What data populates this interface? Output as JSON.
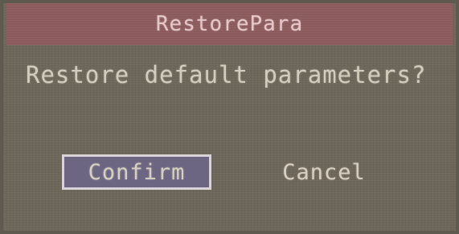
{
  "dialog": {
    "title": "RestorePara",
    "message": "Restore default parameters?",
    "buttons": {
      "confirm_label": "Confirm",
      "cancel_label": "Cancel"
    },
    "selected_button": "Confirm"
  },
  "colors": {
    "background": "#6d675a",
    "titlebar": "#8a5a5c",
    "title_text": "#e6c7c9",
    "text": "#d2ccbc",
    "selected_button_fill": "#6c6682",
    "selected_button_border": "#d9d3d8"
  }
}
